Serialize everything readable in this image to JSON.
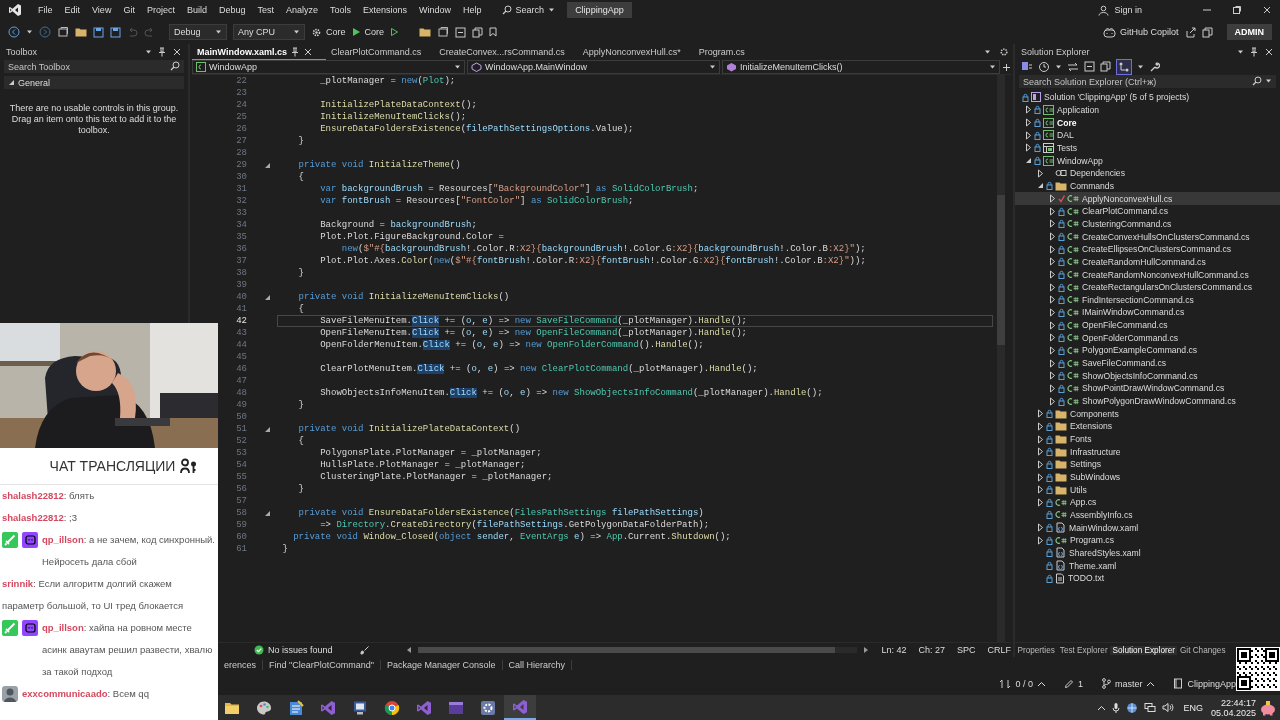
{
  "menu_bar": {
    "items": [
      "File",
      "Edit",
      "View",
      "Git",
      "Project",
      "Build",
      "Debug",
      "Test",
      "Analyze",
      "Tools",
      "Extensions",
      "Window",
      "Help"
    ],
    "search": "Search",
    "solution_name": "ClippingApp",
    "sign_in": "Sign in"
  },
  "toolbar": {
    "configuration": "Debug",
    "platform": "Any CPU",
    "startup_project": "Core",
    "run_target": "Core",
    "copilot": "GitHub Copilot",
    "account": "ADMIN"
  },
  "toolbox": {
    "title": "Toolbox",
    "search": {
      "placeholder": "Search Toolbox"
    },
    "group": {
      "label": "General",
      "expanded": true
    },
    "message": "There are no usable controls in this group. Drag an item onto this text to add it to the toolbox."
  },
  "editor": {
    "tabs": [
      {
        "label": "MainWindow.xaml.cs",
        "selected": true
      },
      {
        "label": "ClearPlotCommand.cs",
        "selected": false
      },
      {
        "label": "CreateConvex...rsCommand.cs",
        "selected": false
      },
      {
        "label": "ApplyNonconvexHull.cs*",
        "selected": false
      },
      {
        "label": "Program.cs",
        "selected": false
      }
    ],
    "navigation": [
      "WindowApp",
      "WindowApp.MainWindow",
      "InitializeMenuItemClicks()"
    ],
    "lines": [
      {
        "number": "22",
        "fold": false,
        "current": false,
        "tokens": [
          {
            "text": "        _plotManager = ",
            "kind": "plain"
          },
          {
            "text": "new",
            "kind": "keyword"
          },
          {
            "text": "(",
            "kind": "plain"
          },
          {
            "text": "Plot",
            "kind": "type"
          },
          {
            "text": ");",
            "kind": "plain"
          }
        ]
      },
      {
        "number": "23",
        "fold": false,
        "current": false
      },
      {
        "number": "24",
        "fold": false,
        "current": false,
        "tokens": [
          {
            "text": "        InitializePlateDataContext",
            "kind": "method"
          },
          {
            "text": "();",
            "kind": "plain"
          }
        ]
      },
      {
        "number": "25",
        "fold": false,
        "current": false,
        "tokens": [
          {
            "text": "        InitializeMenuItemClicks",
            "kind": "method"
          },
          {
            "text": "();",
            "kind": "plain"
          }
        ]
      },
      {
        "number": "26",
        "fold": false,
        "current": false,
        "tokens": [
          {
            "text": "        EnsureDataFoldersExistence",
            "kind": "method"
          },
          {
            "text": "(",
            "kind": "plain"
          },
          {
            "text": "filePathSettingsOptions",
            "kind": "variable"
          },
          {
            "text": ".Value);",
            "kind": "plain"
          }
        ]
      },
      {
        "number": "27",
        "fold": false,
        "current": false,
        "tokens": [
          {
            "text": "    }",
            "kind": "plain"
          }
        ]
      },
      {
        "number": "28",
        "fold": false,
        "current": false
      },
      {
        "number": "29",
        "fold": true,
        "current": false,
        "tokens": [
          {
            "text": "    private void ",
            "kind": "keyword"
          },
          {
            "text": "InitializeTheme",
            "kind": "method"
          },
          {
            "text": "()",
            "kind": "plain"
          }
        ]
      },
      {
        "number": "30",
        "fold": false,
        "current": false,
        "tokens": [
          {
            "text": "    {",
            "kind": "plain"
          }
        ]
      },
      {
        "number": "31",
        "fold": false,
        "current": false,
        "tokens": [
          {
            "text": "        var ",
            "kind": "keyword"
          },
          {
            "text": "backgroundBrush",
            "kind": "variable"
          },
          {
            "text": " = Resources[",
            "kind": "plain"
          },
          {
            "text": "\"BackgroundColor\"",
            "kind": "string"
          },
          {
            "text": "] ",
            "kind": "plain"
          },
          {
            "text": "as ",
            "kind": "keyword"
          },
          {
            "text": "SolidColorBrush",
            "kind": "type"
          },
          {
            "text": ";",
            "kind": "plain"
          }
        ]
      },
      {
        "number": "32",
        "fold": false,
        "current": false,
        "tokens": [
          {
            "text": "        var ",
            "kind": "keyword"
          },
          {
            "text": "fontBrush",
            "kind": "variable"
          },
          {
            "text": " = Resources[",
            "kind": "plain"
          },
          {
            "text": "\"FontColor\"",
            "kind": "string"
          },
          {
            "text": "] ",
            "kind": "plain"
          },
          {
            "text": "as ",
            "kind": "keyword"
          },
          {
            "text": "SolidColorBrush",
            "kind": "type"
          },
          {
            "text": ";",
            "kind": "plain"
          }
        ]
      },
      {
        "number": "33",
        "fold": false,
        "current": false
      },
      {
        "number": "34",
        "fold": false,
        "current": false,
        "tokens": [
          {
            "text": "        Background = ",
            "kind": "plain"
          },
          {
            "text": "backgroundBrush",
            "kind": "variable"
          },
          {
            "text": ";",
            "kind": "plain"
          }
        ]
      },
      {
        "number": "35",
        "fold": false,
        "current": false,
        "tokens": [
          {
            "text": "        Plot.Plot.FigureBackground.Color =",
            "kind": "plain"
          }
        ]
      },
      {
        "number": "36",
        "fold": false,
        "current": false,
        "tokens": [
          {
            "text": "            new",
            "kind": "keyword"
          },
          {
            "text": "(",
            "kind": "plain"
          },
          {
            "text": "$\"#{",
            "kind": "string"
          },
          {
            "text": "backgroundBrush",
            "kind": "variable"
          },
          {
            "text": "!.Color.R",
            "kind": "plain"
          },
          {
            "text": ":X2}{",
            "kind": "string"
          },
          {
            "text": "backgroundBrush",
            "kind": "variable"
          },
          {
            "text": "!.Color.G",
            "kind": "plain"
          },
          {
            "text": ":X2}{",
            "kind": "string"
          },
          {
            "text": "backgroundBrush",
            "kind": "variable"
          },
          {
            "text": "!.Color.B",
            "kind": "plain"
          },
          {
            "text": ":X2}\"",
            "kind": "string"
          },
          {
            "text": ");",
            "kind": "plain"
          }
        ]
      },
      {
        "number": "37",
        "fold": false,
        "current": false,
        "tokens": [
          {
            "text": "        Plot.Plot.Axes.",
            "kind": "plain"
          },
          {
            "text": "Color",
            "kind": "method"
          },
          {
            "text": "(",
            "kind": "plain"
          },
          {
            "text": "new",
            "kind": "keyword"
          },
          {
            "text": "(",
            "kind": "plain"
          },
          {
            "text": "$\"#{",
            "kind": "string"
          },
          {
            "text": "fontBrush",
            "kind": "variable"
          },
          {
            "text": "!.Color.R",
            "kind": "plain"
          },
          {
            "text": ":X2}{",
            "kind": "string"
          },
          {
            "text": "fontBrush",
            "kind": "variable"
          },
          {
            "text": "!.Color.G",
            "kind": "plain"
          },
          {
            "text": ":X2}{",
            "kind": "string"
          },
          {
            "text": "fontBrush",
            "kind": "variable"
          },
          {
            "text": "!.Color.B",
            "kind": "plain"
          },
          {
            "text": ":X2}\"",
            "kind": "string"
          },
          {
            "text": "));",
            "kind": "plain"
          }
        ]
      },
      {
        "number": "38",
        "fold": false,
        "current": false,
        "tokens": [
          {
            "text": "    }",
            "kind": "plain"
          }
        ]
      },
      {
        "number": "39",
        "fold": false,
        "current": false
      },
      {
        "number": "40",
        "fold": true,
        "current": false,
        "tokens": [
          {
            "text": "    private void ",
            "kind": "keyword"
          },
          {
            "text": "InitializeMenuItemClicks",
            "kind": "method"
          },
          {
            "text": "()",
            "kind": "plain"
          }
        ]
      },
      {
        "number": "41",
        "fold": false,
        "current": false,
        "tokens": [
          {
            "text": "    {",
            "kind": "plain"
          }
        ]
      },
      {
        "number": "42",
        "fold": false,
        "current": true,
        "tokens": [
          {
            "text": "        SaveFileMenuItem.",
            "kind": "plain"
          },
          {
            "text": "Click",
            "kind": "reference"
          },
          {
            "text": " += (",
            "kind": "plain"
          },
          {
            "text": "o",
            "kind": "variable"
          },
          {
            "text": ", ",
            "kind": "plain"
          },
          {
            "text": "e",
            "kind": "variable"
          },
          {
            "text": ") => ",
            "kind": "plain"
          },
          {
            "text": "new ",
            "kind": "keyword"
          },
          {
            "text": "SaveFileCommand",
            "kind": "type"
          },
          {
            "text": "(_plotManager).",
            "kind": "plain"
          },
          {
            "text": "Handle",
            "kind": "method"
          },
          {
            "text": "();",
            "kind": "plain"
          }
        ]
      },
      {
        "number": "43",
        "fold": false,
        "current": false,
        "tokens": [
          {
            "text": "        OpenFileMenuItem.",
            "kind": "plain"
          },
          {
            "text": "Click",
            "kind": "reference"
          },
          {
            "text": " += (",
            "kind": "plain"
          },
          {
            "text": "o",
            "kind": "variable"
          },
          {
            "text": ", ",
            "kind": "plain"
          },
          {
            "text": "e",
            "kind": "variable"
          },
          {
            "text": ") => ",
            "kind": "plain"
          },
          {
            "text": "new ",
            "kind": "keyword"
          },
          {
            "text": "OpenFileCommand",
            "kind": "type"
          },
          {
            "text": "(_plotManager).",
            "kind": "plain"
          },
          {
            "text": "Handle",
            "kind": "method"
          },
          {
            "text": "();",
            "kind": "plain"
          }
        ]
      },
      {
        "number": "44",
        "fold": false,
        "current": false,
        "tokens": [
          {
            "text": "        OpenFolderMenuItem.",
            "kind": "plain"
          },
          {
            "text": "Click",
            "kind": "reference"
          },
          {
            "text": " += (",
            "kind": "plain"
          },
          {
            "text": "o",
            "kind": "variable"
          },
          {
            "text": ", ",
            "kind": "plain"
          },
          {
            "text": "e",
            "kind": "variable"
          },
          {
            "text": ") => ",
            "kind": "plain"
          },
          {
            "text": "new ",
            "kind": "keyword"
          },
          {
            "text": "OpenFolderCommand",
            "kind": "type"
          },
          {
            "text": "().",
            "kind": "plain"
          },
          {
            "text": "Handle",
            "kind": "method"
          },
          {
            "text": "();",
            "kind": "plain"
          }
        ]
      },
      {
        "number": "45",
        "fold": false,
        "current": false
      },
      {
        "number": "46",
        "fold": false,
        "current": false,
        "tokens": [
          {
            "text": "        ClearPlotMenuItem.",
            "kind": "plain"
          },
          {
            "text": "Click",
            "kind": "reference"
          },
          {
            "text": " += (",
            "kind": "plain"
          },
          {
            "text": "o",
            "kind": "variable"
          },
          {
            "text": ", ",
            "kind": "plain"
          },
          {
            "text": "e",
            "kind": "variable"
          },
          {
            "text": ") => ",
            "kind": "plain"
          },
          {
            "text": "new ",
            "kind": "keyword"
          },
          {
            "text": "ClearPlotCommand",
            "kind": "type"
          },
          {
            "text": "(_plotManager).",
            "kind": "plain"
          },
          {
            "text": "Handle",
            "kind": "method"
          },
          {
            "text": "();",
            "kind": "plain"
          }
        ]
      },
      {
        "number": "47",
        "fold": false,
        "current": false
      },
      {
        "number": "48",
        "fold": false,
        "current": false,
        "tokens": [
          {
            "text": "        ShowObjectsInfoMenuItem.",
            "kind": "plain"
          },
          {
            "text": "Click",
            "kind": "reference"
          },
          {
            "text": " += (",
            "kind": "plain"
          },
          {
            "text": "o",
            "kind": "variable"
          },
          {
            "text": ", ",
            "kind": "plain"
          },
          {
            "text": "e",
            "kind": "variable"
          },
          {
            "text": ") => ",
            "kind": "plain"
          },
          {
            "text": "new ",
            "kind": "keyword"
          },
          {
            "text": "ShowObjectsInfoCommand",
            "kind": "type"
          },
          {
            "text": "(_plotManager).",
            "kind": "plain"
          },
          {
            "text": "Handle",
            "kind": "method"
          },
          {
            "text": "();",
            "kind": "plain"
          }
        ]
      },
      {
        "number": "49",
        "fold": false,
        "current": false,
        "tokens": [
          {
            "text": "    }",
            "kind": "plain"
          }
        ]
      },
      {
        "number": "50",
        "fold": false,
        "current": false
      },
      {
        "number": "51",
        "fold": true,
        "current": false,
        "tokens": [
          {
            "text": "    private void ",
            "kind": "keyword"
          },
          {
            "text": "InitializePlateDataContext",
            "kind": "method"
          },
          {
            "text": "()",
            "kind": "plain"
          }
        ]
      },
      {
        "number": "52",
        "fold": false,
        "current": false,
        "tokens": [
          {
            "text": "    {",
            "kind": "plain"
          }
        ]
      },
      {
        "number": "53",
        "fold": false,
        "current": false,
        "tokens": [
          {
            "text": "        PolygonsPlate.PlotManager = _plotManager;",
            "kind": "plain"
          }
        ]
      },
      {
        "number": "54",
        "fold": false,
        "current": false,
        "tokens": [
          {
            "text": "        HullsPlate.PlotManager = _plotManager;",
            "kind": "plain"
          }
        ]
      },
      {
        "number": "55",
        "fold": false,
        "current": false,
        "tokens": [
          {
            "text": "        ClusteringPlate.PlotManager = _plotManager;",
            "kind": "plain"
          }
        ]
      },
      {
        "number": "56",
        "fold": false,
        "current": false,
        "tokens": [
          {
            "text": "    }",
            "kind": "plain"
          }
        ]
      },
      {
        "number": "57",
        "fold": false,
        "current": false
      },
      {
        "number": "58",
        "fold": true,
        "current": false,
        "tokens": [
          {
            "text": "    private void ",
            "kind": "keyword"
          },
          {
            "text": "EnsureDataFoldersExistence",
            "kind": "method"
          },
          {
            "text": "(",
            "kind": "plain"
          },
          {
            "text": "FilesPathSettings",
            "kind": "type"
          },
          {
            "text": " filePathSettings",
            "kind": "variable"
          },
          {
            "text": ")",
            "kind": "plain"
          }
        ]
      },
      {
        "number": "59",
        "fold": false,
        "current": false,
        "tokens": [
          {
            "text": "        => ",
            "kind": "plain"
          },
          {
            "text": "Directory",
            "kind": "type"
          },
          {
            "text": ".",
            "kind": "plain"
          },
          {
            "text": "CreateDirectory",
            "kind": "method"
          },
          {
            "text": "(",
            "kind": "plain"
          },
          {
            "text": "filePathSettings",
            "kind": "variable"
          },
          {
            "text": ".GetPolygonDataFolderPath);",
            "kind": "plain"
          }
        ]
      },
      {
        "number": "60",
        "fold": false,
        "current": false,
        "tokens": [
          {
            "text": "   private void ",
            "kind": "keyword"
          },
          {
            "text": "Window_Closed",
            "kind": "method"
          },
          {
            "text": "(",
            "kind": "plain"
          },
          {
            "text": "object",
            "kind": "keyword"
          },
          {
            "text": " sender",
            "kind": "variable"
          },
          {
            "text": ", ",
            "kind": "plain"
          },
          {
            "text": "EventArgs",
            "kind": "type"
          },
          {
            "text": " e",
            "kind": "variable"
          },
          {
            "text": ") => ",
            "kind": "plain"
          },
          {
            "text": "App",
            "kind": "type"
          },
          {
            "text": ".Current.",
            "kind": "plain"
          },
          {
            "text": "Shutdown",
            "kind": "method"
          },
          {
            "text": "();",
            "kind": "plain"
          }
        ]
      },
      {
        "number": "61",
        "fold": false,
        "current": false,
        "tokens": [
          {
            "text": " }",
            "kind": "plain"
          }
        ]
      }
    ],
    "status": {
      "issues": "No issues found",
      "line": "Ln: 42",
      "column": "Ch: 27",
      "indent": "SPC",
      "line_ending": "CRLF"
    }
  },
  "solution_explorer": {
    "title": "Solution Explorer",
    "search": {
      "placeholder": "Search Solution Explorer (Ctrl+ж)"
    },
    "tree": [
      {
        "label": "Solution 'ClippingApp' (5 of 5 projects)",
        "kind": "solution",
        "selected": false,
        "children": [
          {
            "label": "Application",
            "kind": "project",
            "expanded": false,
            "startup": false,
            "selected": false
          },
          {
            "label": "Core",
            "kind": "project",
            "expanded": false,
            "startup": true,
            "selected": false
          },
          {
            "label": "DAL",
            "kind": "project",
            "expanded": false,
            "startup": false,
            "selected": false
          },
          {
            "label": "Tests",
            "kind": "test-project",
            "expanded": false,
            "startup": false,
            "selected": false
          },
          {
            "label": "WindowApp",
            "kind": "project",
            "expanded": true,
            "startup": false,
            "selected": false,
            "children": [
              {
                "label": "Dependencies",
                "kind": "dependencies",
                "expanded": false,
                "selected": false
              },
              {
                "label": "Commands",
                "kind": "folder",
                "expanded": true,
                "selected": false,
                "children": [
                  {
                    "label": "ApplyNonconvexHull.cs",
                    "kind": "cs",
                    "expanded": false,
                    "modified": true,
                    "selected": true
                  },
                  {
                    "label": "ClearPlotCommand.cs",
                    "kind": "cs",
                    "expanded": false,
                    "modified": false,
                    "selected": false
                  },
                  {
                    "label": "ClusteringCommand.cs",
                    "kind": "cs",
                    "expanded": false,
                    "modified": false,
                    "selected": false
                  },
                  {
                    "label": "CreateConvexHullsOnClustersCommand.cs",
                    "kind": "cs",
                    "expanded": false,
                    "modified": false,
                    "selected": false
                  },
                  {
                    "label": "CreateEllipsesOnClustersCommand.cs",
                    "kind": "cs",
                    "expanded": false,
                    "modified": false,
                    "selected": false
                  },
                  {
                    "label": "CreateRandomHullCommand.cs",
                    "kind": "cs",
                    "expanded": false,
                    "modified": false,
                    "selected": false
                  },
                  {
                    "label": "CreateRandomNonconvexHullCommand.cs",
                    "kind": "cs",
                    "expanded": false,
                    "modified": false,
                    "selected": false
                  },
                  {
                    "label": "CreateRectangularsOnClustersCommand.cs",
                    "kind": "cs",
                    "expanded": false,
                    "modified": false,
                    "selected": false
                  },
                  {
                    "label": "FindIntersectionCommand.cs",
                    "kind": "cs",
                    "expanded": false,
                    "modified": false,
                    "selected": false
                  },
                  {
                    "label": "IMainWindowCommand.cs",
                    "kind": "cs",
                    "expanded": false,
                    "modified": false,
                    "selected": false
                  },
                  {
                    "label": "OpenFileCommand.cs",
                    "kind": "cs",
                    "expanded": false,
                    "modified": false,
                    "selected": false
                  },
                  {
                    "label": "OpenFolderCommand.cs",
                    "kind": "cs",
                    "expanded": false,
                    "modified": false,
                    "selected": false
                  },
                  {
                    "label": "PolygonExampleCommand.cs",
                    "kind": "cs",
                    "expanded": false,
                    "modified": false,
                    "selected": false
                  },
                  {
                    "label": "SaveFileCommand.cs",
                    "kind": "cs",
                    "expanded": false,
                    "modified": false,
                    "selected": false
                  },
                  {
                    "label": "ShowObjectsInfoCommand.cs",
                    "kind": "cs",
                    "expanded": false,
                    "modified": false,
                    "selected": false
                  },
                  {
                    "label": "ShowPointDrawWindowCommand.cs",
                    "kind": "cs",
                    "expanded": false,
                    "modified": false,
                    "selected": false
                  },
                  {
                    "label": "ShowPolygonDrawWindowCommand.cs",
                    "kind": "cs",
                    "expanded": false,
                    "modified": false,
                    "selected": false
                  }
                ]
              },
              {
                "label": "Components",
                "kind": "folder",
                "expanded": false,
                "selected": false
              },
              {
                "label": "Extensions",
                "kind": "folder",
                "expanded": false,
                "selected": false
              },
              {
                "label": "Fonts",
                "kind": "folder",
                "expanded": false,
                "selected": false
              },
              {
                "label": "Infrastructure",
                "kind": "folder",
                "expanded": false,
                "selected": false
              },
              {
                "label": "Settings",
                "kind": "folder",
                "expanded": false,
                "selected": false
              },
              {
                "label": "SubWindows",
                "kind": "folder",
                "expanded": false,
                "selected": false
              },
              {
                "label": "Utils",
                "kind": "folder",
                "expanded": false,
                "selected": false
              },
              {
                "label": "App.cs",
                "kind": "cs",
                "expanded": false,
                "selected": false
              },
              {
                "label": "AssemblyInfo.cs",
                "kind": "cs",
                "selected": false
              },
              {
                "label": "MainWindow.xaml",
                "kind": "xaml",
                "expanded": false,
                "selected": false
              },
              {
                "label": "Program.cs",
                "kind": "cs",
                "expanded": false,
                "selected": false
              },
              {
                "label": "SharedStyles.xaml",
                "kind": "xaml",
                "selected": false
              },
              {
                "label": "Theme.xaml",
                "kind": "xaml",
                "selected": false
              },
              {
                "label": "TODO.txt",
                "kind": "text",
                "selected": false
              }
            ]
          }
        ]
      }
    ],
    "tabs": [
      {
        "label": "Properties",
        "selected": false
      },
      {
        "label": "Test Explorer",
        "selected": false
      },
      {
        "label": "Solution Explorer",
        "selected": true
      },
      {
        "label": "Git Changes",
        "selected": false
      }
    ]
  },
  "tool_tabs": [
    "erences",
    "Find \"ClearPlotCommand\"",
    "Package Manager Console",
    "Call Hierarchy"
  ],
  "status_bar": {
    "sync": "0 / 0",
    "changes": "1",
    "branch": "master",
    "repository": "ClippingApp"
  },
  "stream_chat": {
    "title": "ЧАТ ТРАНСЛЯЦИИ",
    "messages": [
      {
        "text": "**shalash22812**: блять"
      },
      {
        "text": "**shalash22812**: ;3"
      },
      {
        "badges": [
          {
            "kind": "sword"
          },
          {
            "kind": "bot"
          }
        ],
        "text": "**qp_illson**: а не зачем, код синхронный. Нейросеть дала сбой"
      },
      {
        "text": "**srinnik**: Если алгоритм долгий скажем параметр большой, то UI тред блокается"
      },
      {
        "badges": [
          {
            "kind": "sword"
          },
          {
            "kind": "bot"
          }
        ],
        "text": "**qp_illson**: хайпа на ровном месте асинк аваутам решил развести, хвалю за такой подход"
      },
      {
        "badges": [
          {
            "kind": "avatar"
          }
        ],
        "text": "**exxcommunicaado**: Всем qq"
      }
    ]
  },
  "taskbar": {
    "language": "ENG",
    "time": "22:44:17",
    "date": "05.04.2025"
  }
}
